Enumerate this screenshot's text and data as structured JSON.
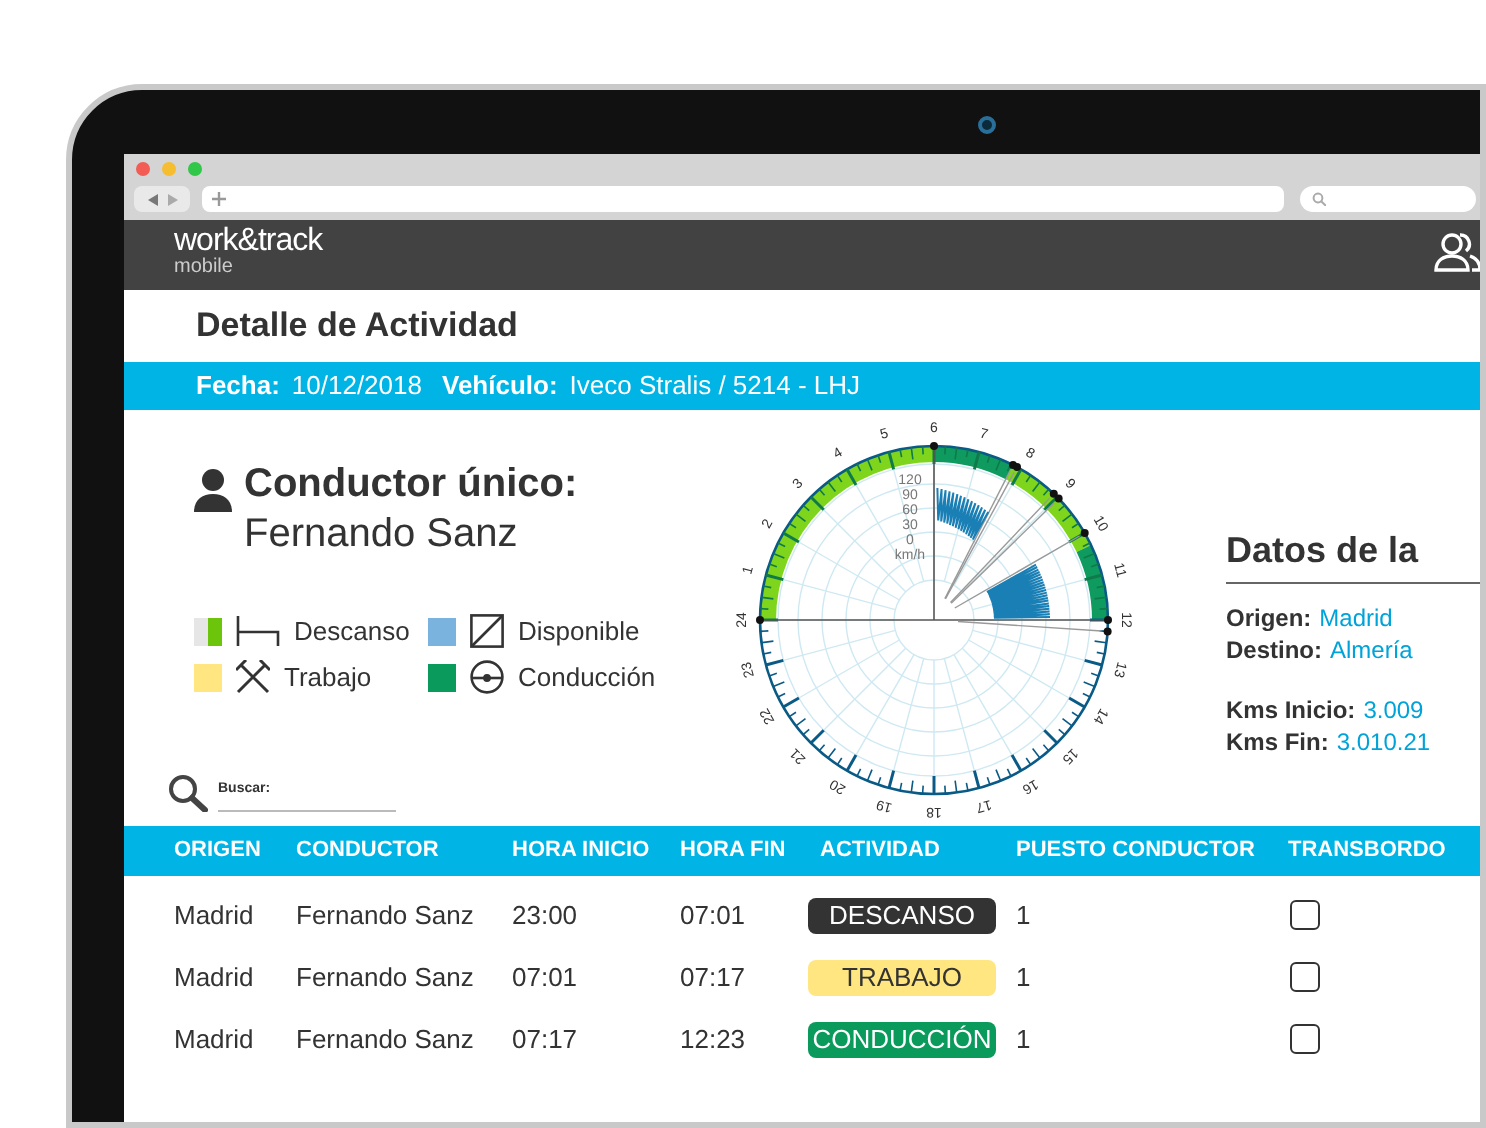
{
  "app_header": {
    "logo": "work&track",
    "logo_subtitle": "mobile"
  },
  "page_title": "Detalle de Actividad",
  "info_bar": [
    {
      "label": "Fecha:",
      "value": "10/12/2018"
    },
    {
      "label": "Vehículo:",
      "value": "Iveco Stralis / 5214 - LHJ"
    }
  ],
  "driver": {
    "heading": "Conductor único:",
    "name": "Fernando Sanz"
  },
  "legend": [
    {
      "kind": "descanso",
      "label": "Descanso",
      "color": "#6cc50a"
    },
    {
      "kind": "disponible",
      "label": "Disponible",
      "color": "#7ab3de"
    },
    {
      "kind": "trabajo",
      "label": "Trabajo",
      "color": "#ffe680"
    },
    {
      "kind": "conduccion",
      "label": "Conducción",
      "color": "#0a9a5b"
    }
  ],
  "search": {
    "label": "Buscar:"
  },
  "chart": {
    "speed_labels": [
      "120",
      "90",
      "60",
      "30",
      "0"
    ],
    "unit": "km/h",
    "hour_labels": [
      "1",
      "2",
      "3",
      "4",
      "5",
      "6",
      "7",
      "8",
      "9",
      "10",
      "11",
      "12",
      "13",
      "14",
      "15",
      "16",
      "17",
      "18",
      "19",
      "20",
      "21",
      "22",
      "23",
      "24"
    ]
  },
  "details": {
    "heading": "Datos de la",
    "route": [
      {
        "label": "Origen:",
        "value": "Madrid"
      },
      {
        "label": "Destino:",
        "value": "Almería"
      }
    ],
    "odometer": [
      {
        "label": "Kms Inicio:",
        "value": "3.009"
      },
      {
        "label": "Kms Fin:",
        "value": "3.010.21"
      }
    ]
  },
  "table": {
    "columns": [
      "ORIGEN",
      "CONDUCTOR",
      "HORA INICIO",
      "HORA FIN",
      "ACTIVIDAD",
      "PUESTO CONDUCTOR",
      "TRANSBORDO"
    ],
    "rows": [
      {
        "origen": "Madrid",
        "conductor": "Fernando Sanz",
        "hora_inicio": "23:00",
        "hora_fin": "07:01",
        "actividad": {
          "label": "DESCANSO",
          "color": "#333333"
        },
        "puesto_conductor": "1",
        "transbordo": {
          "checked": false
        }
      },
      {
        "origen": "Madrid",
        "conductor": "Fernando Sanz",
        "hora_inicio": "07:01",
        "hora_fin": "07:17",
        "actividad": {
          "label": "TRABAJO",
          "color": "#ffe680"
        },
        "puesto_conductor": "1",
        "transbordo": {
          "checked": false
        }
      },
      {
        "origen": "Madrid",
        "conductor": "Fernando Sanz",
        "hora_inicio": "07:17",
        "hora_fin": "12:23",
        "actividad": {
          "label": "CONDUCCIÓN",
          "color": "#0a9a5b"
        },
        "puesto_conductor": "1",
        "transbordo": {
          "checked": false
        }
      }
    ]
  }
}
